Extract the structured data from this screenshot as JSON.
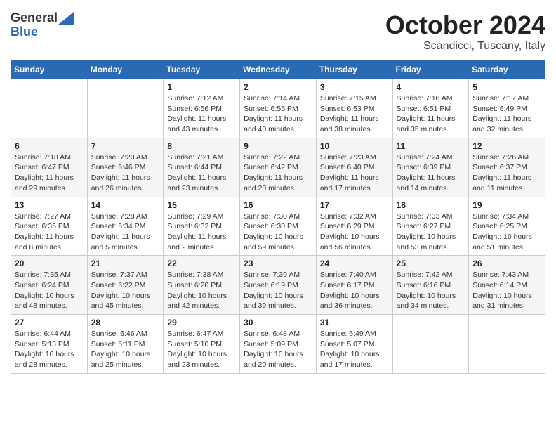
{
  "header": {
    "logo_general": "General",
    "logo_blue": "Blue",
    "title": "October 2024",
    "location": "Scandicci, Tuscany, Italy"
  },
  "weekdays": [
    "Sunday",
    "Monday",
    "Tuesday",
    "Wednesday",
    "Thursday",
    "Friday",
    "Saturday"
  ],
  "weeks": [
    [
      {
        "day": "",
        "sunrise": "",
        "sunset": "",
        "daylight": ""
      },
      {
        "day": "",
        "sunrise": "",
        "sunset": "",
        "daylight": ""
      },
      {
        "day": "1",
        "sunrise": "Sunrise: 7:12 AM",
        "sunset": "Sunset: 6:56 PM",
        "daylight": "Daylight: 11 hours and 43 minutes."
      },
      {
        "day": "2",
        "sunrise": "Sunrise: 7:14 AM",
        "sunset": "Sunset: 6:55 PM",
        "daylight": "Daylight: 11 hours and 40 minutes."
      },
      {
        "day": "3",
        "sunrise": "Sunrise: 7:15 AM",
        "sunset": "Sunset: 6:53 PM",
        "daylight": "Daylight: 11 hours and 38 minutes."
      },
      {
        "day": "4",
        "sunrise": "Sunrise: 7:16 AM",
        "sunset": "Sunset: 6:51 PM",
        "daylight": "Daylight: 11 hours and 35 minutes."
      },
      {
        "day": "5",
        "sunrise": "Sunrise: 7:17 AM",
        "sunset": "Sunset: 6:49 PM",
        "daylight": "Daylight: 11 hours and 32 minutes."
      }
    ],
    [
      {
        "day": "6",
        "sunrise": "Sunrise: 7:18 AM",
        "sunset": "Sunset: 6:47 PM",
        "daylight": "Daylight: 11 hours and 29 minutes."
      },
      {
        "day": "7",
        "sunrise": "Sunrise: 7:20 AM",
        "sunset": "Sunset: 6:46 PM",
        "daylight": "Daylight: 11 hours and 26 minutes."
      },
      {
        "day": "8",
        "sunrise": "Sunrise: 7:21 AM",
        "sunset": "Sunset: 6:44 PM",
        "daylight": "Daylight: 11 hours and 23 minutes."
      },
      {
        "day": "9",
        "sunrise": "Sunrise: 7:22 AM",
        "sunset": "Sunset: 6:42 PM",
        "daylight": "Daylight: 11 hours and 20 minutes."
      },
      {
        "day": "10",
        "sunrise": "Sunrise: 7:23 AM",
        "sunset": "Sunset: 6:40 PM",
        "daylight": "Daylight: 11 hours and 17 minutes."
      },
      {
        "day": "11",
        "sunrise": "Sunrise: 7:24 AM",
        "sunset": "Sunset: 6:39 PM",
        "daylight": "Daylight: 11 hours and 14 minutes."
      },
      {
        "day": "12",
        "sunrise": "Sunrise: 7:26 AM",
        "sunset": "Sunset: 6:37 PM",
        "daylight": "Daylight: 11 hours and 11 minutes."
      }
    ],
    [
      {
        "day": "13",
        "sunrise": "Sunrise: 7:27 AM",
        "sunset": "Sunset: 6:35 PM",
        "daylight": "Daylight: 11 hours and 8 minutes."
      },
      {
        "day": "14",
        "sunrise": "Sunrise: 7:28 AM",
        "sunset": "Sunset: 6:34 PM",
        "daylight": "Daylight: 11 hours and 5 minutes."
      },
      {
        "day": "15",
        "sunrise": "Sunrise: 7:29 AM",
        "sunset": "Sunset: 6:32 PM",
        "daylight": "Daylight: 11 hours and 2 minutes."
      },
      {
        "day": "16",
        "sunrise": "Sunrise: 7:30 AM",
        "sunset": "Sunset: 6:30 PM",
        "daylight": "Daylight: 10 hours and 59 minutes."
      },
      {
        "day": "17",
        "sunrise": "Sunrise: 7:32 AM",
        "sunset": "Sunset: 6:29 PM",
        "daylight": "Daylight: 10 hours and 56 minutes."
      },
      {
        "day": "18",
        "sunrise": "Sunrise: 7:33 AM",
        "sunset": "Sunset: 6:27 PM",
        "daylight": "Daylight: 10 hours and 53 minutes."
      },
      {
        "day": "19",
        "sunrise": "Sunrise: 7:34 AM",
        "sunset": "Sunset: 6:25 PM",
        "daylight": "Daylight: 10 hours and 51 minutes."
      }
    ],
    [
      {
        "day": "20",
        "sunrise": "Sunrise: 7:35 AM",
        "sunset": "Sunset: 6:24 PM",
        "daylight": "Daylight: 10 hours and 48 minutes."
      },
      {
        "day": "21",
        "sunrise": "Sunrise: 7:37 AM",
        "sunset": "Sunset: 6:22 PM",
        "daylight": "Daylight: 10 hours and 45 minutes."
      },
      {
        "day": "22",
        "sunrise": "Sunrise: 7:38 AM",
        "sunset": "Sunset: 6:20 PM",
        "daylight": "Daylight: 10 hours and 42 minutes."
      },
      {
        "day": "23",
        "sunrise": "Sunrise: 7:39 AM",
        "sunset": "Sunset: 6:19 PM",
        "daylight": "Daylight: 10 hours and 39 minutes."
      },
      {
        "day": "24",
        "sunrise": "Sunrise: 7:40 AM",
        "sunset": "Sunset: 6:17 PM",
        "daylight": "Daylight: 10 hours and 36 minutes."
      },
      {
        "day": "25",
        "sunrise": "Sunrise: 7:42 AM",
        "sunset": "Sunset: 6:16 PM",
        "daylight": "Daylight: 10 hours and 34 minutes."
      },
      {
        "day": "26",
        "sunrise": "Sunrise: 7:43 AM",
        "sunset": "Sunset: 6:14 PM",
        "daylight": "Daylight: 10 hours and 31 minutes."
      }
    ],
    [
      {
        "day": "27",
        "sunrise": "Sunrise: 6:44 AM",
        "sunset": "Sunset: 5:13 PM",
        "daylight": "Daylight: 10 hours and 28 minutes."
      },
      {
        "day": "28",
        "sunrise": "Sunrise: 6:46 AM",
        "sunset": "Sunset: 5:11 PM",
        "daylight": "Daylight: 10 hours and 25 minutes."
      },
      {
        "day": "29",
        "sunrise": "Sunrise: 6:47 AM",
        "sunset": "Sunset: 5:10 PM",
        "daylight": "Daylight: 10 hours and 23 minutes."
      },
      {
        "day": "30",
        "sunrise": "Sunrise: 6:48 AM",
        "sunset": "Sunset: 5:09 PM",
        "daylight": "Daylight: 10 hours and 20 minutes."
      },
      {
        "day": "31",
        "sunrise": "Sunrise: 6:49 AM",
        "sunset": "Sunset: 5:07 PM",
        "daylight": "Daylight: 10 hours and 17 minutes."
      },
      {
        "day": "",
        "sunrise": "",
        "sunset": "",
        "daylight": ""
      },
      {
        "day": "",
        "sunrise": "",
        "sunset": "",
        "daylight": ""
      }
    ]
  ]
}
